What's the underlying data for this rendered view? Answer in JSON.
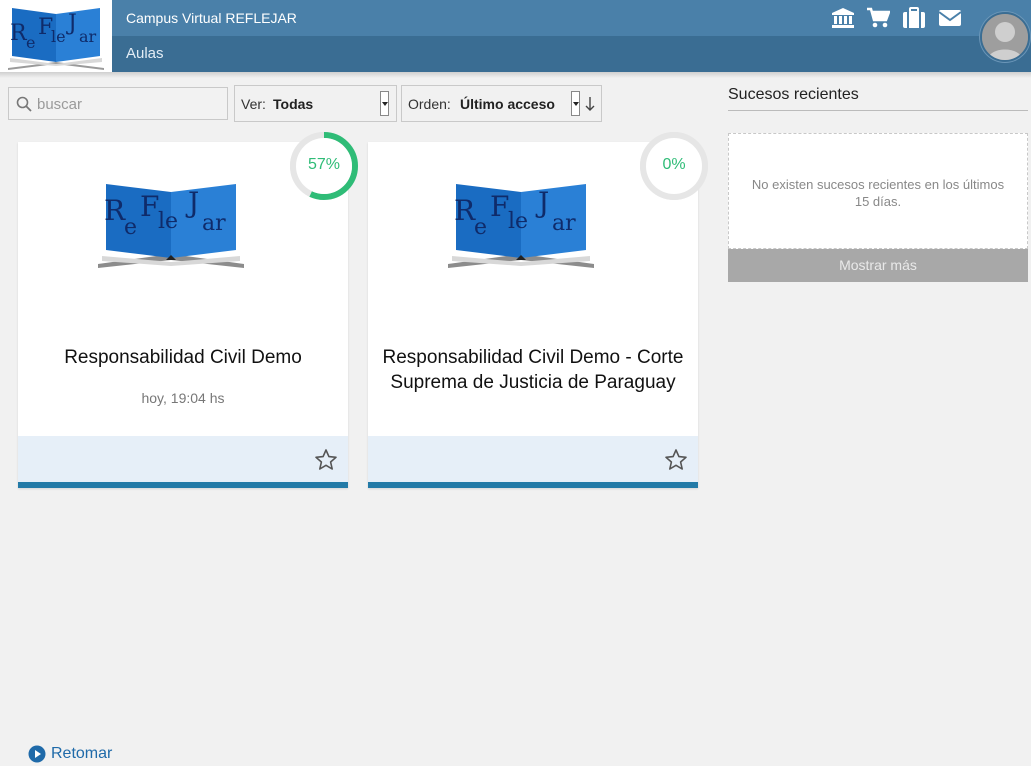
{
  "header": {
    "site_title": "Campus Virtual REFLEJAR",
    "section": "Aulas",
    "icons": [
      "bank-icon",
      "cart-icon",
      "briefcase-icon",
      "mail-icon"
    ],
    "logo_text": [
      "R",
      "e",
      "F",
      "le",
      "J",
      "ar"
    ]
  },
  "filters": {
    "search_placeholder": "buscar",
    "ver_label": "Ver:",
    "ver_value": "Todas",
    "orden_label": "Orden:",
    "orden_value": "Último acceso"
  },
  "courses": [
    {
      "title": "Responsabilidad Civil Demo",
      "time": "hoy, 19:04 hs",
      "progress_label": "57%",
      "progress": 0.57,
      "action": "Retomar"
    },
    {
      "title": "Responsabilidad Civil Demo - Corte Suprema de Justicia de Paraguay",
      "time": "",
      "progress_label": "0%",
      "progress": 0.0,
      "action": ""
    }
  ],
  "recent": {
    "title": "Sucesos recientes",
    "message": "No existen sucesos recientes en los últimos 15 días.",
    "more": "Mostrar más"
  },
  "colors": {
    "header_top": "#4a80a9",
    "header_sub": "#3a6d93",
    "progress": "#2fbc77",
    "card_bar": "#237aa7",
    "link": "#1f6aa9"
  }
}
